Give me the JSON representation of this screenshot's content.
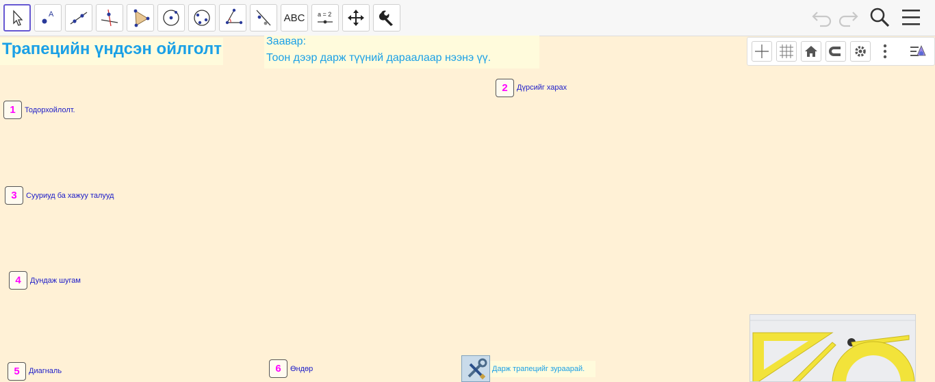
{
  "toolbar": {
    "tools": [
      {
        "name": "move-tool-button",
        "icon": "pointer-icon"
      },
      {
        "name": "point-tool-button",
        "icon": "point-icon",
        "label": "A"
      },
      {
        "name": "line-tool-button",
        "icon": "line-icon"
      },
      {
        "name": "perpendicular-line-tool-button",
        "icon": "perpendicular-icon"
      },
      {
        "name": "polygon-tool-button",
        "icon": "polygon-icon"
      },
      {
        "name": "circle-tool-button",
        "icon": "circle-center-icon"
      },
      {
        "name": "conic-tool-button",
        "icon": "ellipse-icon"
      },
      {
        "name": "angle-tool-button",
        "icon": "angle-icon"
      },
      {
        "name": "reflect-tool-button",
        "icon": "reflect-icon"
      },
      {
        "name": "text-tool-button",
        "icon": "text-icon",
        "label": "ABC"
      },
      {
        "name": "slider-tool-button",
        "icon": "slider-icon",
        "label": "a = 2"
      },
      {
        "name": "move-graphics-view-tool-button",
        "icon": "move-arrows-icon"
      },
      {
        "name": "tools-settings-button",
        "icon": "wrench-icon"
      }
    ],
    "undo_icon": "undo-icon",
    "redo_icon": "redo-icon",
    "search_icon": "search-icon",
    "menu_icon": "menu-icon",
    "active_color": "#6557d2"
  },
  "stylebar": {
    "buttons": [
      "axes-icon",
      "grid-icon",
      "home-icon",
      "magnet-icon",
      "gear-icon",
      "more-vertical-icon",
      "view-menu-icon"
    ]
  },
  "title": "Трапецийн үндсэн ойлголт",
  "instruction": {
    "label": "Заавар:",
    "text": "Тоон дээр дарж түүний дараалаар нээнэ үү."
  },
  "sections": [
    {
      "num": "1",
      "label": "Тодорхойлолт."
    },
    {
      "num": "2",
      "label": "Дүрсийг харах"
    },
    {
      "num": "3",
      "label": "Сууриуд ба хажуу талууд"
    },
    {
      "num": "4",
      "label": "Дундаж шугам"
    },
    {
      "num": "5",
      "label": "Диагналь"
    },
    {
      "num": "6",
      "label": "Өндөр"
    }
  ],
  "draw_prompt": "Дарж трапецийг зураарай.",
  "colors": {
    "background": "#fff1d6",
    "title": "#1aa0e6",
    "number": "#ff00ff",
    "label": "#1a1ac8"
  }
}
